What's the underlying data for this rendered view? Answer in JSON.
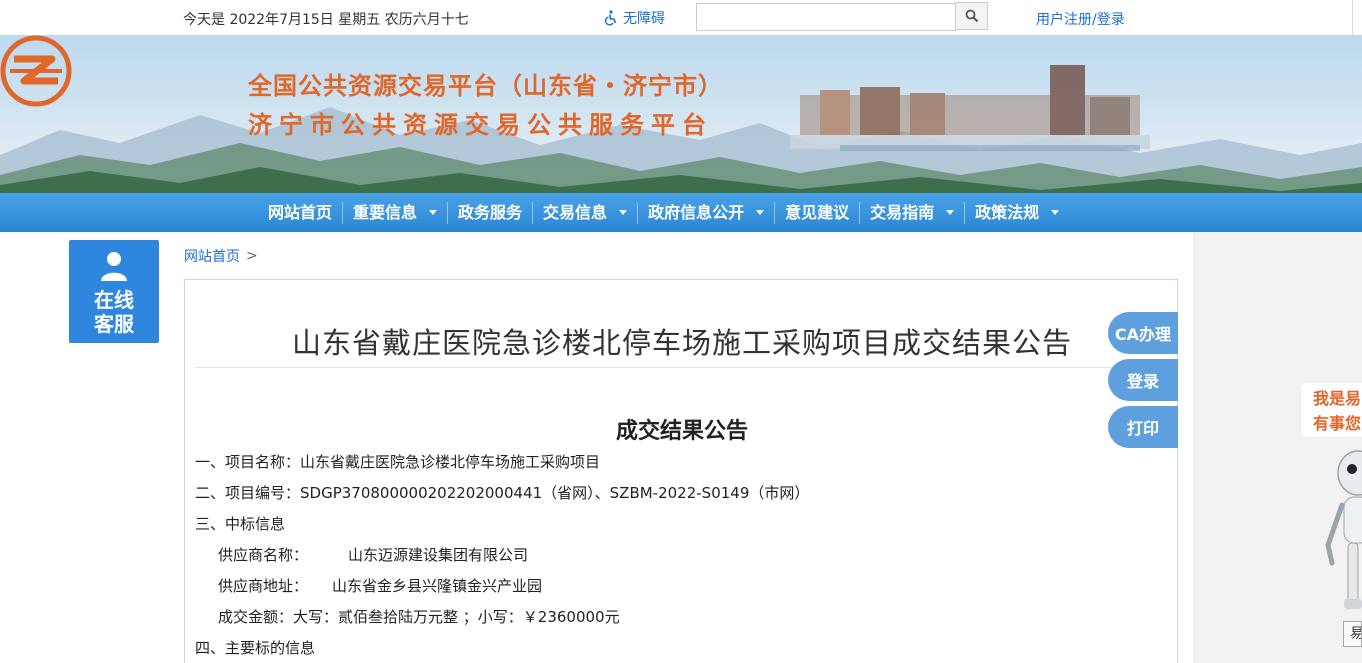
{
  "topbar": {
    "date_text": "今天是 2022年7月15日 星期五 农历六月十七",
    "accessibility_label": "无障碍",
    "search_placeholder": "",
    "login_label": "用户注册/登录"
  },
  "banner": {
    "title_line1": "全国公共资源交易平台（山东省・济宁市）",
    "title_line2": "济宁市公共资源交易公共服务平台"
  },
  "nav": {
    "items": [
      {
        "label": "网站首页"
      },
      {
        "label": "重要信息"
      },
      {
        "label": "政务服务"
      },
      {
        "label": "交易信息"
      },
      {
        "label": "政府信息公开"
      },
      {
        "label": "意见建议"
      },
      {
        "label": "交易指南"
      },
      {
        "label": "政策法规"
      }
    ]
  },
  "sidebar": {
    "customer_service_line1": "在线",
    "customer_service_line2": "客服"
  },
  "breadcrumb": {
    "home": "网站首页",
    "separator": ">"
  },
  "article": {
    "title": "山东省戴庄医院急诊楼北停车场施工采购项目成交结果公告",
    "subtitle": "成交结果公告",
    "lines": {
      "project_name": "一、项目名称：山东省戴庄医院急诊楼北停车场施工采购项目",
      "project_number": "二、项目编号：SDGP370800000202202000441（省网）、SZBM-2022-S0149（市网）",
      "winning_info": "三、中标信息",
      "supplier_name_label": "供应商名称：",
      "supplier_name_value": "山东迈源建设集团有限公司",
      "supplier_address_label": "供应商地址：",
      "supplier_address_value": "山东省金乡县兴隆镇金兴产业园",
      "amount": "成交金额：大写：贰佰叁拾陆万元整 ；小写：￥2360000元",
      "main_subject": "四、主要标的信息"
    }
  },
  "side_buttons": {
    "ca": "CA办理",
    "login": "登录",
    "print": "打印"
  },
  "robot": {
    "bubble_line1": "我是易",
    "bubble_line2": "有事您",
    "button": "易"
  },
  "colors": {
    "brand_orange": "#e1662a",
    "nav_blue": "#2b86d3",
    "link_blue": "#1e6fd6",
    "side_button_blue": "#5ea0dd"
  }
}
